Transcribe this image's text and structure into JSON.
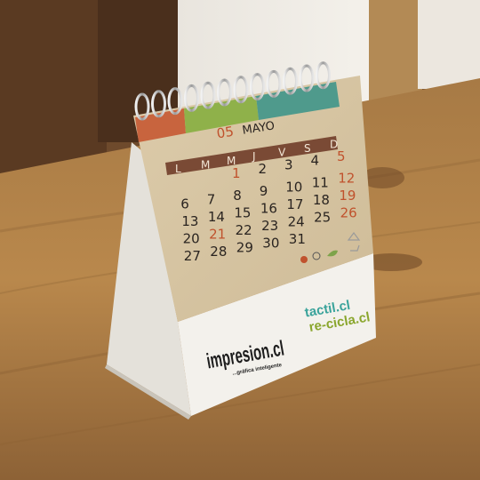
{
  "calendar": {
    "month_number": "05",
    "month_name": "MAYO",
    "weekdays": [
      "L",
      "M",
      "M",
      "J",
      "V",
      "S",
      "D"
    ],
    "weeks": [
      [
        "",
        "",
        "",
        "1",
        "2",
        "3",
        "4",
        "5"
      ],
      [
        "6",
        "7",
        "8",
        "9",
        "10",
        "11",
        "12"
      ],
      [
        "13",
        "14",
        "15",
        "16",
        "17",
        "18",
        "19"
      ],
      [
        "20",
        "21",
        "22",
        "23",
        "24",
        "25",
        "26"
      ],
      [
        "27",
        "28",
        "29",
        "30",
        "31"
      ]
    ]
  },
  "brands": {
    "left_name": "impresion.cl",
    "left_tagline": "...gráfica inteligente",
    "right_line1": "tactil.cl",
    "right_line2": "re-cicla.cl"
  },
  "colors": {
    "tab_red": "#c8643e",
    "tab_green": "#8fb14a",
    "tab_teal": "#4f9a8c",
    "paper": "#d9c8a6",
    "ink": "#2a2420",
    "accent": "#c0522d",
    "brand_teal": "#3aa39b",
    "brand_olive": "#8aa62d"
  }
}
